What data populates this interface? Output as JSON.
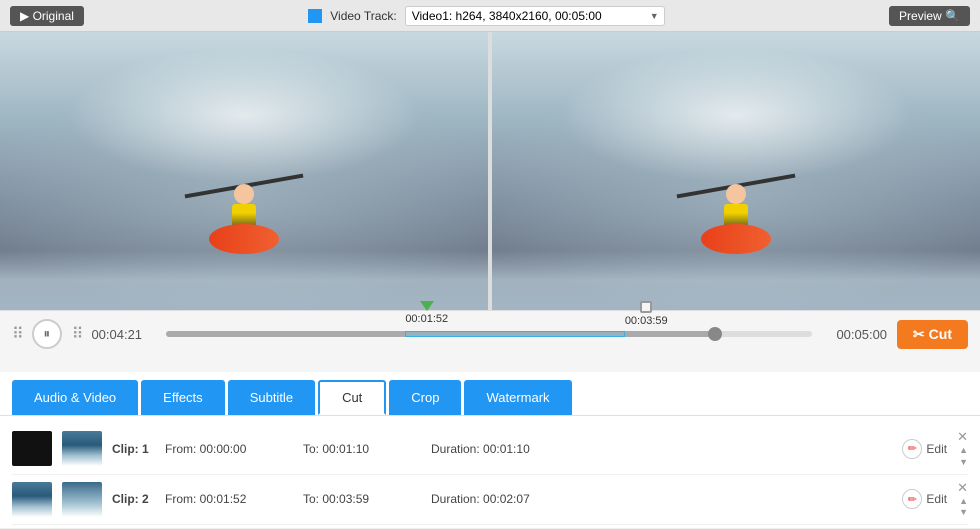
{
  "topBar": {
    "originalLabel": "▶ Original",
    "videoTrackLabel": "Video Track:",
    "videoTrackValue": "Video1: h264, 3840x2160, 00:05:00",
    "previewLabel": "Preview 🔍"
  },
  "controls": {
    "currentTime": "00:04:21",
    "endTime": "00:05:00",
    "cutLabel": "✂ Cut",
    "markerLeft": "00:01:52",
    "markerRight": "00:03:59"
  },
  "tabs": [
    {
      "id": "audio-video",
      "label": "Audio & Video",
      "active": false
    },
    {
      "id": "effects",
      "label": "Effects",
      "active": false
    },
    {
      "id": "subtitle",
      "label": "Subtitle",
      "active": false
    },
    {
      "id": "cut",
      "label": "Cut",
      "active": true
    },
    {
      "id": "crop",
      "label": "Crop",
      "active": false
    },
    {
      "id": "watermark",
      "label": "Watermark",
      "active": false
    }
  ],
  "clips": [
    {
      "id": 1,
      "label": "Clip: 1",
      "from": "From:  00:00:00",
      "to": "To:  00:01:10",
      "duration": "Duration: 00:01:10",
      "thumbType": "black"
    },
    {
      "id": 2,
      "label": "Clip: 2",
      "from": "From:  00:01:52",
      "to": "To:  00:03:59",
      "duration": "Duration: 00:02:07",
      "thumbType": "waterfall"
    }
  ]
}
